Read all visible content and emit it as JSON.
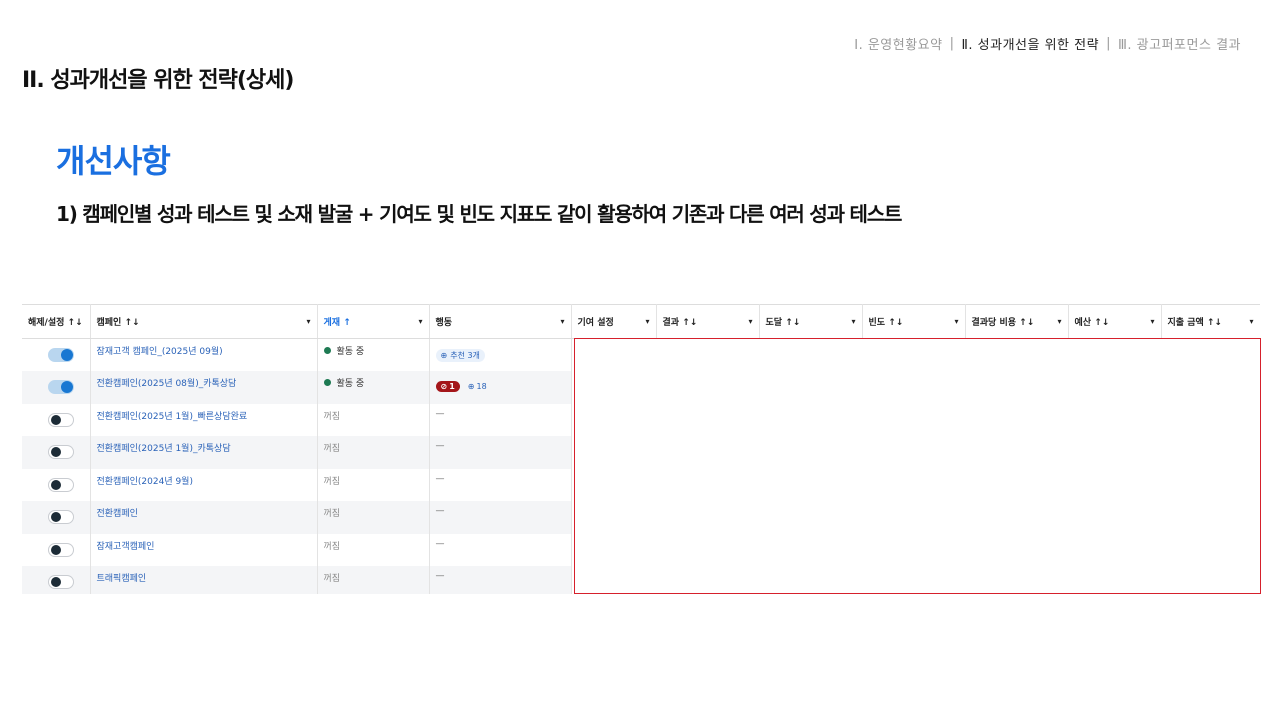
{
  "nav": {
    "items": [
      {
        "label": "Ⅰ. 운영현황요약",
        "active": false
      },
      {
        "label": "Ⅱ. 성과개선을 위한 전략",
        "active": true
      },
      {
        "label": "Ⅲ. 광고퍼포먼스 결과",
        "active": false
      }
    ],
    "separator": "|"
  },
  "section_title": "II. 성과개선을 위한 전략(상세)",
  "heading": "개선사항",
  "subheading": "1) 캠페인별 성과 테스트 및 소재 발굴 + 기여도 및 빈도 지표도 같이 활용하여 기존과 다른 여러 성과 테스트",
  "table": {
    "columns": [
      {
        "label": "해제/설정 ↑↓",
        "dropdown": false
      },
      {
        "label": "캠페인 ↑↓",
        "dropdown": true
      },
      {
        "label": "게재 ↑",
        "dropdown": true,
        "active": true
      },
      {
        "label": "행동",
        "dropdown": true
      },
      {
        "label": "기여 설정",
        "dropdown": true
      },
      {
        "label": "결과 ↑↓",
        "dropdown": true
      },
      {
        "label": "도달 ↑↓",
        "dropdown": true
      },
      {
        "label": "빈도 ↑↓",
        "dropdown": true
      },
      {
        "label": "결과당 비용 ↑↓",
        "dropdown": true
      },
      {
        "label": "예산 ↑↓",
        "dropdown": true
      },
      {
        "label": "지출 금액 ↑↓",
        "dropdown": true
      }
    ],
    "caret": "▾",
    "rows": [
      {
        "toggle_on": true,
        "campaign": "잠재고객 캠페인_(2025년 09월)",
        "delivery": "활동 중",
        "active": true,
        "action_type": "chip",
        "action_text": "추천 3개"
      },
      {
        "toggle_on": true,
        "campaign": "전환캠페인(2025년 08월)_카톡상담",
        "delivery": "활동 중",
        "active": true,
        "action_type": "badges",
        "error_count": "1",
        "rec_count": "18"
      },
      {
        "toggle_on": false,
        "campaign": "전환캠페인(2025년 1월)_빠른상담완료",
        "delivery": "꺼짐",
        "active": false,
        "action_type": "dash",
        "action_text": "—"
      },
      {
        "toggle_on": false,
        "campaign": "전환캠페인(2025년 1월)_카톡상담",
        "delivery": "꺼짐",
        "active": false,
        "action_type": "dash",
        "action_text": "—"
      },
      {
        "toggle_on": false,
        "campaign": "전환캠페인(2024년 9월)",
        "delivery": "꺼짐",
        "active": false,
        "action_type": "dash",
        "action_text": "—"
      },
      {
        "toggle_on": false,
        "campaign": "전환캠페인",
        "delivery": "꺼짐",
        "active": false,
        "action_type": "dash",
        "action_text": "—"
      },
      {
        "toggle_on": false,
        "campaign": "잠재고객캠페인",
        "delivery": "꺼짐",
        "active": false,
        "action_type": "dash",
        "action_text": "—"
      },
      {
        "toggle_on": false,
        "campaign": "트래픽캠페인",
        "delivery": "꺼짐",
        "active": false,
        "action_type": "dash",
        "action_text": "—"
      }
    ]
  },
  "colors": {
    "accent": "#1a6fe0",
    "highlight_border": "#d6202c",
    "active_dot": "#1e7a53",
    "error_badge": "#a4161a"
  }
}
